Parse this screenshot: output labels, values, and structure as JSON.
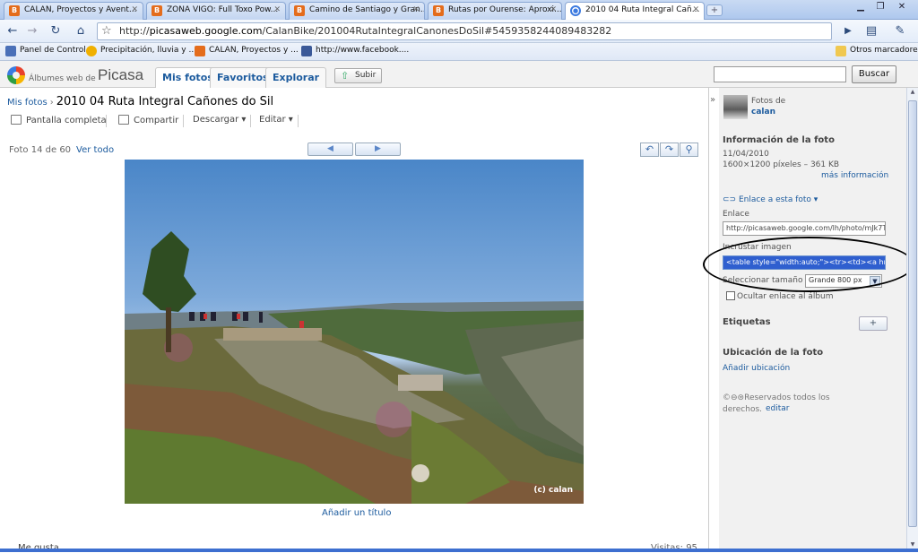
{
  "browser": {
    "tabs": [
      {
        "label": "CALAN, Proyectos y Avent...",
        "icon": "blogger-icon",
        "active": false
      },
      {
        "label": "ZONA VIGO: Full Toxo Pow...",
        "icon": "blogger-icon",
        "active": false
      },
      {
        "label": "Camino de Santiago y Gran...",
        "icon": "blogger-icon",
        "active": false
      },
      {
        "label": "Rutas por Ourense: Aproxi...",
        "icon": "blogger-icon",
        "active": false
      },
      {
        "label": "2010 04 Ruta Integral Cañ...",
        "icon": "picasa-icon",
        "active": true
      }
    ],
    "new_tab": "+",
    "url_domain": "picasaweb.google.com",
    "url_prefix": "http://",
    "url_path": "/CalanBike/201004RutaIntegralCanonesDoSil#5459358244089483282",
    "bookmarks": [
      {
        "label": "Panel de Control",
        "color": "#4a70b8"
      },
      {
        "label": "Precipitación, lluvia y ...",
        "color": "#f0b000"
      },
      {
        "label": "CALAN, Proyectos y ...",
        "color": "#e46c1b"
      },
      {
        "label": "http://www.facebook....",
        "color": "#3b5998"
      }
    ],
    "other_bookmarks": "Otros marcadores"
  },
  "picasa": {
    "logo_small": "Álbumes web de",
    "logo_big": "Picasa",
    "nav": [
      "Mis fotos",
      "Favoritos",
      "Explorar"
    ],
    "upload": "Subir",
    "search_value": "",
    "search_button": "Buscar"
  },
  "main": {
    "breadcrumb_link": "Mis fotos",
    "breadcrumb_sep": "›",
    "album_title": "2010 04 Ruta Integral Cañones do Sil",
    "actions": {
      "fullscreen": "Pantalla completa",
      "share": "Compartir",
      "download": "Descargar",
      "edit": "Editar"
    },
    "counter": "Foto 14 de 60",
    "view_all": "Ver todo",
    "prev": "◀",
    "next": "▶",
    "watermark": "(c) calan",
    "caption": "Añadir un título",
    "bottom_left": "Me gusta",
    "bottom_right": "Visitas: 95"
  },
  "side": {
    "photos_of": "Fotos de",
    "owner": "calan",
    "info_title": "Información de la foto",
    "date": "11/04/2010",
    "dims": "1600×1200 píxeles – 361 KB",
    "more_info": "más información",
    "link_toggle": "Enlace a esta foto ▾",
    "link_label": "Enlace",
    "link_value": "http://picasaweb.google.com/lh/photo/mJk7T_",
    "embed_label": "Incrustar imagen",
    "embed_value": "<table style=\"width:auto;\"><tr><td><a href=\"h",
    "size_label": "Seleccionar tamaño",
    "size_value": "Grande 800 px",
    "hide_link": "Ocultar enlace al álbum",
    "tags_title": "Etiquetas",
    "add_tag": "+",
    "location_title": "Ubicación de la foto",
    "add_location": "Añadir ubicación",
    "rights": "Reservados todos los",
    "rights2": "derechos.",
    "rights_edit": "editar"
  }
}
